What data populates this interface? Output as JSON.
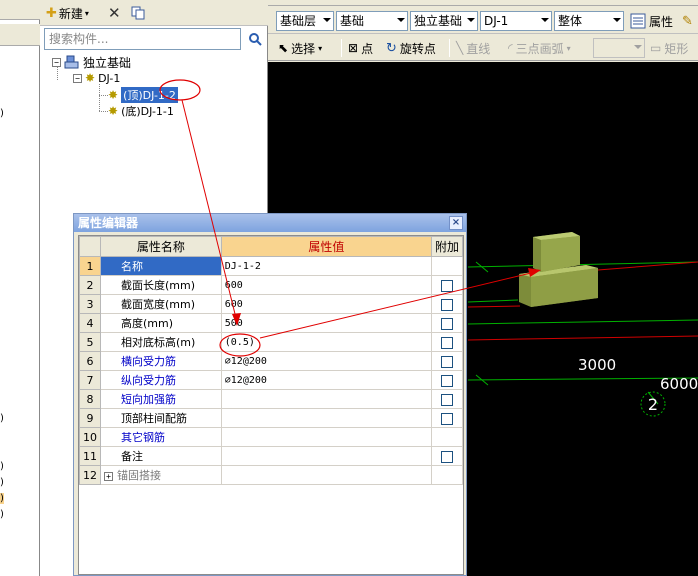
{
  "tree_panel": {
    "toolbar": {
      "new_label": "新建"
    },
    "search": {
      "placeholder": "搜索构件..."
    },
    "tree": {
      "root": "独立基础",
      "child": "DJ-1",
      "leaves": [
        "(顶)DJ-1-2",
        "(底)DJ-1-1"
      ]
    }
  },
  "toolbar1": {
    "layer": "基础层",
    "category": "基础",
    "type": "独立基础",
    "component": "DJ-1",
    "unit": "整体",
    "property_label": "属性"
  },
  "toolbar2": {
    "select": "选择",
    "point": "点",
    "rotate_point": "旋转点",
    "line": "直线",
    "arc": "三点画弧",
    "rect": "矩形"
  },
  "canvas": {
    "dim_3000": "3000",
    "dim_6000": "6000",
    "axis_2": "2"
  },
  "prop_editor": {
    "title": "属性编辑器",
    "close": "×",
    "headers": {
      "name": "属性名称",
      "value": "属性值",
      "extra": "附加"
    },
    "rows": [
      {
        "num": "1",
        "name": "名称",
        "value": "DJ-1-2",
        "checkbox": false
      },
      {
        "num": "2",
        "name": "截面长度(mm)",
        "value": "600",
        "checkbox": true
      },
      {
        "num": "3",
        "name": "截面宽度(mm)",
        "value": "600",
        "checkbox": true
      },
      {
        "num": "4",
        "name": "高度(mm)",
        "value": "500",
        "checkbox": true
      },
      {
        "num": "5",
        "name": "相对底标高(m)",
        "value": "(0.5)",
        "checkbox": true
      },
      {
        "num": "6",
        "name": "横向受力筋",
        "value": "⌀12@200",
        "checkbox": true
      },
      {
        "num": "7",
        "name": "纵向受力筋",
        "value": "⌀12@200",
        "checkbox": true
      },
      {
        "num": "8",
        "name": "短向加强筋",
        "value": "",
        "checkbox": true
      },
      {
        "num": "9",
        "name": "顶部柱间配筋",
        "value": "",
        "checkbox": true
      },
      {
        "num": "10",
        "name": "其它钢筋",
        "value": "",
        "checkbox": false
      },
      {
        "num": "11",
        "name": "备注",
        "value": "",
        "checkbox": true
      },
      {
        "num": "12",
        "name": "锚固搭接",
        "value": "",
        "checkbox": false,
        "expander": "+"
      }
    ]
  }
}
